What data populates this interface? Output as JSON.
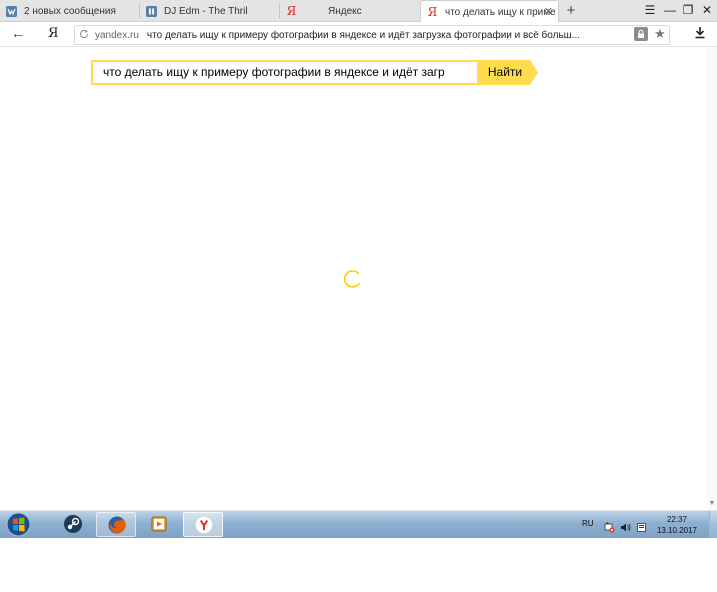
{
  "tabs": [
    {
      "title": "2 новых сообщения",
      "icon": "vk-icon"
    },
    {
      "title": "DJ Edm - The Thril",
      "icon": "pause-icon"
    },
    {
      "title": "Яндекс",
      "icon": "yandex-icon"
    },
    {
      "title": "что делать ищу к приме",
      "icon": "yandex-icon",
      "active": true
    }
  ],
  "tab_icon_glyph": "Я",
  "tab_close_glyph": "✕",
  "new_tab_glyph": "+",
  "window_controls": {
    "menu": "☰",
    "minimize": "—",
    "restore": "❐",
    "close": "✕"
  },
  "address_bar": {
    "back_glyph": "←",
    "yandex_button": "Я",
    "domain": "yandex.ru",
    "query": "что делать ищу к примеру фотографии в яндексе и идёт загрузка фотографии и всё больш..."
  },
  "search": {
    "value": "что делать ищу к примеру фотографии в яндексе и идёт загр",
    "button_label": "Найти"
  },
  "taskbar": {
    "language": "RU",
    "time": "22:37",
    "date": "13.10.2017"
  },
  "colors": {
    "yandex_yellow": "#ffdb4d",
    "spinner": "#ffcc00",
    "yandex_red": "#e52620",
    "vk_blue": "#5b7fa6"
  }
}
